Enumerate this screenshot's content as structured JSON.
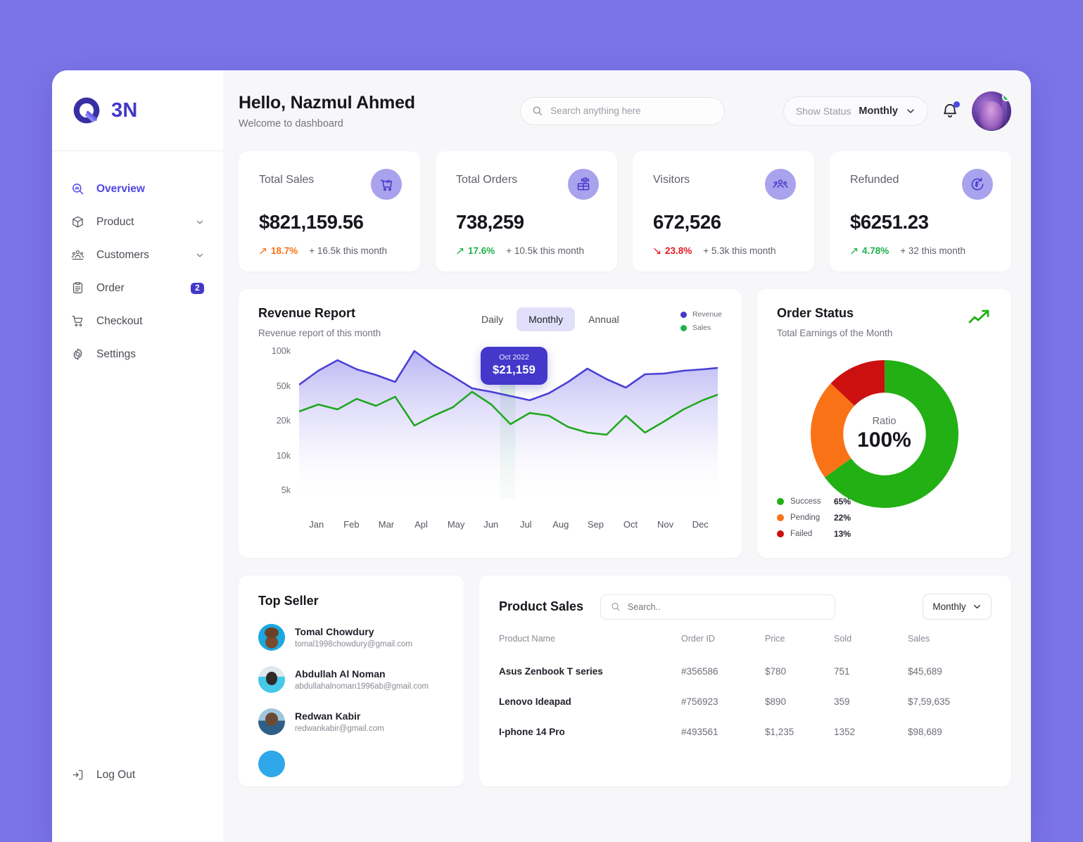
{
  "brand": {
    "name": "3N",
    "logo_icon": "q-logo-icon"
  },
  "sidebar": {
    "items": [
      {
        "label": "Overview",
        "icon": "overview-search-icon",
        "active": true
      },
      {
        "label": "Product",
        "icon": "box-icon",
        "chevron": true
      },
      {
        "label": "Customers",
        "icon": "users-icon",
        "chevron": true
      },
      {
        "label": "Order",
        "icon": "clipboard-icon",
        "badge": "2"
      },
      {
        "label": "Checkout",
        "icon": "cart-icon"
      },
      {
        "label": "Settings",
        "icon": "gear-icon"
      }
    ],
    "logout": {
      "label": "Log Out",
      "icon": "logout-icon"
    }
  },
  "header": {
    "greeting": "Hello, Nazmul Ahmed",
    "subtitle": "Welcome to dashboard",
    "search_placeholder": "Search anything here",
    "search_value": "",
    "status_label": "Show Status",
    "status_value": "Monthly",
    "bell_icon": "bell-icon",
    "has_notification": true,
    "avatar_online": true
  },
  "stats": [
    {
      "title": "Total Sales",
      "value": "$821,159.56",
      "pct": "18.7%",
      "direction": "up",
      "pct_color": "#f97316",
      "note": "+ 16.5k this month",
      "icon": "sales-cart-icon"
    },
    {
      "title": "Total Orders",
      "value": "738,259",
      "pct": "17.6%",
      "direction": "up",
      "pct_color": "#1eb24b",
      "note": "+ 10.5k this month",
      "icon": "orders-box-icon"
    },
    {
      "title": "Visitors",
      "value": "672,526",
      "pct": "23.8%",
      "direction": "down",
      "pct_color": "#e01b24",
      "note": "+ 5.3k this month",
      "icon": "visitors-people-icon"
    },
    {
      "title": "Refunded",
      "value": "$6251.23",
      "pct": "4.78%",
      "direction": "up",
      "pct_color": "#1eb24b",
      "note": "+ 32 this month",
      "icon": "refund-icon"
    }
  ],
  "revenue": {
    "title": "Revenue Report",
    "subtitle": "Revenue report of this month",
    "ranges": [
      {
        "label": "Daily",
        "active": false
      },
      {
        "label": "Monthly",
        "active": true
      },
      {
        "label": "Annual",
        "active": false
      }
    ],
    "tooltip": {
      "date": "Oct 2022",
      "value": "$21,159"
    }
  },
  "order_status": {
    "title": "Order Status",
    "subtitle": "Total Earnings of the Month",
    "trend_icon": "trend-up-icon",
    "center_label": "Ratio",
    "center_value": "100%"
  },
  "top_seller": {
    "title": "Top Seller",
    "sellers": [
      {
        "name": "Tomal Chowdury",
        "email": "tomal1998chowdury@gmail.com"
      },
      {
        "name": "Abdullah Al Noman",
        "email": "abdullahalnoman1996ab@gmail.com"
      },
      {
        "name": "Redwan Kabir",
        "email": "redwankabir@gmail.com"
      }
    ]
  },
  "product_sales": {
    "title": "Product Sales",
    "search_placeholder": "Search..",
    "search_value": "",
    "period": "Monthly",
    "columns": [
      "Product Name",
      "Order ID",
      "Price",
      "Sold",
      "Sales"
    ],
    "rows": [
      {
        "name": "Asus Zenbook T series",
        "order_id": "#356586",
        "price": "$780",
        "sold": "751",
        "sales": "$45,689"
      },
      {
        "name": "Lenovo Ideapad",
        "order_id": "#756923",
        "price": "$890",
        "sold": "359",
        "sales": "$7,59,635"
      },
      {
        "name": "I-phone 14 Pro",
        "order_id": "#493561",
        "price": "$1,235",
        "sold": "1352",
        "sales": "$98,689"
      }
    ]
  },
  "chart_data": [
    {
      "type": "area",
      "title": "Revenue Report",
      "subtitle": "Revenue report of this month",
      "categories": [
        "Jan",
        "Feb",
        "Mar",
        "Apl",
        "May",
        "Jun",
        "Jul",
        "Aug",
        "Sep",
        "Oct",
        "Nov",
        "Dec"
      ],
      "ytick_labels": [
        "100k",
        "50k",
        "20k",
        "10k",
        "5k"
      ],
      "ytick_values": [
        100000,
        50000,
        20000,
        10000,
        5000
      ],
      "ylabel": "",
      "xlabel": "",
      "grid": false,
      "legend": [
        {
          "name": "Revenue",
          "color": "#4338ca"
        },
        {
          "name": "Sales",
          "color": "#1eb24b"
        }
      ],
      "series": [
        {
          "name": "Revenue",
          "color": "#4338ca",
          "values": [
            38000,
            44000,
            50000,
            45000,
            42000,
            39000,
            63000,
            52000,
            44000,
            36000,
            34000,
            31000,
            28000,
            33000,
            41000,
            50000,
            43000,
            37000,
            49000,
            48000,
            50000
          ]
        },
        {
          "name": "Sales",
          "color": "#1eb24b",
          "values": [
            27000,
            30000,
            28000,
            33000,
            30000,
            34000,
            21000,
            26000,
            29000,
            37000,
            31000,
            23000,
            28000,
            27000,
            21000,
            19000,
            18000,
            27000,
            19000,
            25000,
            32000
          ]
        }
      ],
      "annotation": {
        "x": "Oct",
        "date": "Oct 2022",
        "value": "$21,159"
      }
    },
    {
      "type": "pie",
      "title": "Order Status",
      "subtitle": "Total Earnings of the Month",
      "center_label": "Ratio",
      "center_value": "100%",
      "labels": [
        "Success",
        "Pending",
        "Failed"
      ],
      "values": [
        65,
        22,
        13
      ],
      "value_labels": [
        "65%",
        "22%",
        "13%"
      ],
      "colors": [
        "#22b014",
        "#f97316",
        "#cc1010"
      ],
      "legend_position": "bottom-left"
    }
  ],
  "colors": {
    "page_background": "#7b74e8",
    "accent": "#4338ca",
    "panel": "#f7f7f9",
    "card": "#ffffff",
    "success": "#1eb24b",
    "danger": "#e01b24",
    "warning": "#f97316"
  }
}
